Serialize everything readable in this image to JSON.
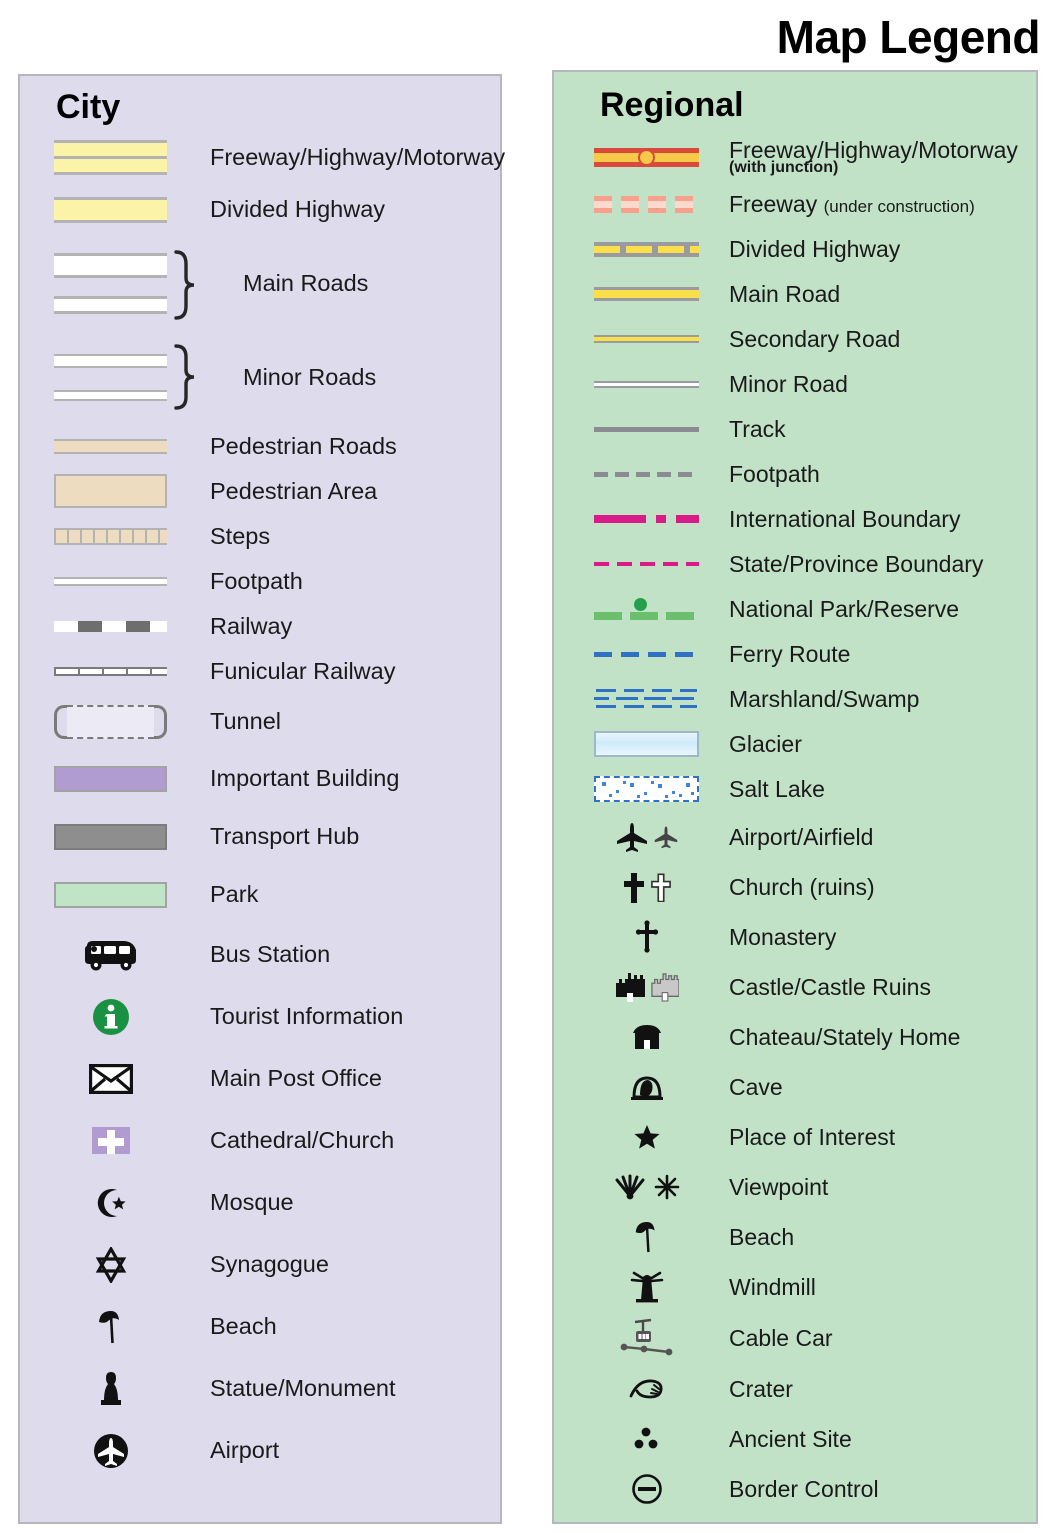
{
  "title": "Map Legend",
  "city": {
    "heading": "City",
    "bg_color": "#dedbec",
    "items": [
      {
        "icon": "freeway-city-swatch",
        "label": "Freeway/Highway/Motorway"
      },
      {
        "icon": "divided-highway-city-swatch",
        "label": "Divided Highway"
      },
      {
        "icon": "main-roads-swatch",
        "label": "Main Roads"
      },
      {
        "icon": "minor-roads-swatch",
        "label": "Minor Roads"
      },
      {
        "icon": "pedestrian-roads-swatch",
        "label": "Pedestrian Roads"
      },
      {
        "icon": "pedestrian-area-swatch",
        "label": "Pedestrian Area"
      },
      {
        "icon": "steps-swatch",
        "label": "Steps"
      },
      {
        "icon": "footpath-swatch",
        "label": "Footpath"
      },
      {
        "icon": "railway-swatch",
        "label": "Railway"
      },
      {
        "icon": "funicular-railway-swatch",
        "label": "Funicular Railway"
      },
      {
        "icon": "tunnel-swatch",
        "label": "Tunnel"
      },
      {
        "icon": "important-building-swatch",
        "label": "Important Building"
      },
      {
        "icon": "transport-hub-swatch",
        "label": "Transport Hub"
      },
      {
        "icon": "park-swatch",
        "label": "Park"
      },
      {
        "icon": "bus-icon",
        "label": "Bus Station"
      },
      {
        "icon": "tourist-information-icon",
        "label": "Tourist Information"
      },
      {
        "icon": "envelope-icon",
        "label": "Main Post Office"
      },
      {
        "icon": "cathedral-church-icon",
        "label": "Cathedral/Church"
      },
      {
        "icon": "mosque-crescent-icon",
        "label": "Mosque"
      },
      {
        "icon": "synagogue-star-icon",
        "label": "Synagogue"
      },
      {
        "icon": "beach-umbrella-icon",
        "label": "Beach"
      },
      {
        "icon": "statue-monument-icon",
        "label": "Statue/Monument"
      },
      {
        "icon": "airport-plane-icon",
        "label": "Airport"
      }
    ]
  },
  "regional": {
    "heading": "Regional",
    "bg_color": "#c2e2c8",
    "items": [
      {
        "icon": "freeway-junction-swatch",
        "label": "Freeway/Highway/Motorway",
        "sub": "(with junction)"
      },
      {
        "icon": "freeway-under-construction-swatch",
        "label": "Freeway ",
        "sub_inline": "(under construction)"
      },
      {
        "icon": "divided-highway-regional-swatch",
        "label": "Divided Highway"
      },
      {
        "icon": "main-road-swatch",
        "label": "Main Road"
      },
      {
        "icon": "secondary-road-swatch",
        "label": "Secondary Road"
      },
      {
        "icon": "minor-road-swatch",
        "label": "Minor Road"
      },
      {
        "icon": "track-swatch",
        "label": "Track"
      },
      {
        "icon": "footpath-regional-swatch",
        "label": "Footpath"
      },
      {
        "icon": "international-boundary-swatch",
        "label": "International Boundary"
      },
      {
        "icon": "state-province-boundary-swatch",
        "label": "State/Province Boundary"
      },
      {
        "icon": "national-park-swatch",
        "label": "National Park/Reserve"
      },
      {
        "icon": "ferry-route-swatch",
        "label": "Ferry Route"
      },
      {
        "icon": "marshland-swamp-swatch",
        "label": "Marshland/Swamp"
      },
      {
        "icon": "glacier-swatch",
        "label": "Glacier"
      },
      {
        "icon": "salt-lake-swatch",
        "label": "Salt Lake"
      },
      {
        "icon": "airport-airfield-icon",
        "label": "Airport/Airfield"
      },
      {
        "icon": "church-ruins-cross-icon",
        "label": "Church (ruins)"
      },
      {
        "icon": "monastery-cross-icon",
        "label": "Monastery"
      },
      {
        "icon": "castle-icon",
        "label": "Castle/Castle Ruins"
      },
      {
        "icon": "chateau-icon",
        "label": "Chateau/Stately Home"
      },
      {
        "icon": "cave-icon",
        "label": "Cave"
      },
      {
        "icon": "star-icon",
        "label": "Place of Interest"
      },
      {
        "icon": "viewpoint-icon",
        "label": "Viewpoint"
      },
      {
        "icon": "beach-umbrella-icon",
        "label": "Beach"
      },
      {
        "icon": "windmill-icon",
        "label": "Windmill"
      },
      {
        "icon": "cable-car-icon",
        "label": "Cable Car"
      },
      {
        "icon": "crater-icon",
        "label": "Crater"
      },
      {
        "icon": "ancient-site-icon",
        "label": "Ancient Site"
      },
      {
        "icon": "border-control-icon",
        "label": "Border Control"
      }
    ]
  },
  "colors": {
    "city_panel": "#dedbec",
    "regional_panel": "#c2e2c8",
    "road_yellow": "#f9e04b",
    "freeway_red": "#d94a3d",
    "boundary_magenta": "#d81b86",
    "ferry_blue": "#2f72c4",
    "park_green": "#6cbf6c",
    "building_purple": "#b09cd0",
    "info_green": "#1a9142"
  }
}
